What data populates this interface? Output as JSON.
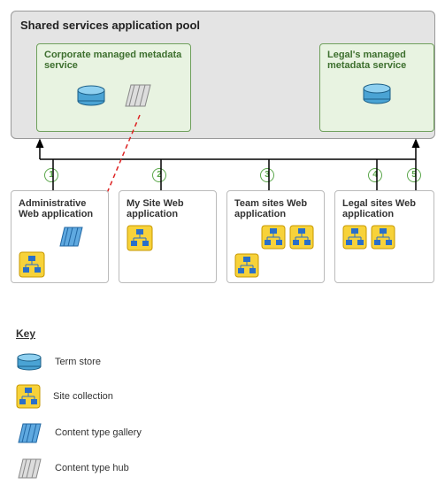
{
  "pool": {
    "title": "Shared services application pool"
  },
  "services": {
    "corporate": {
      "title": "Corporate managed metadata service"
    },
    "legal": {
      "title": "Legal's managed metadata service"
    }
  },
  "apps": {
    "admin": {
      "title": "Administrative Web application"
    },
    "mysite": {
      "title": "My Site Web application"
    },
    "team": {
      "title": "Team sites Web application"
    },
    "legal": {
      "title": "Legal sites Web application"
    }
  },
  "connections": {
    "n1": "1",
    "n2": "2",
    "n3": "3",
    "n4": "4",
    "n5": "5"
  },
  "key": {
    "title": "Key",
    "term_store": "Term store",
    "site_collection": "Site collection",
    "content_type_gallery": "Content type gallery",
    "content_type_hub": "Content type hub"
  }
}
